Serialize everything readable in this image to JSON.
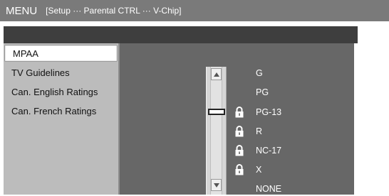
{
  "header": {
    "menu_label": "MENU",
    "breadcrumb": "[Setup ··· Parental CTRL ··· V-Chip]"
  },
  "sidebar": {
    "items": [
      {
        "label": "MPAA",
        "selected": true
      },
      {
        "label": "TV Guidelines",
        "selected": false
      },
      {
        "label": "Can. English Ratings",
        "selected": false
      },
      {
        "label": "Can. French Ratings",
        "selected": false
      }
    ]
  },
  "ratings": {
    "items": [
      {
        "label": "G",
        "locked": false
      },
      {
        "label": "PG",
        "locked": false
      },
      {
        "label": "PG-13",
        "locked": true
      },
      {
        "label": "R",
        "locked": true
      },
      {
        "label": "NC-17",
        "locked": true
      },
      {
        "label": "X",
        "locked": true
      },
      {
        "label": "NONE",
        "locked": false
      }
    ],
    "lock_icon": "padlock-icon",
    "slider_position": "PG-13"
  },
  "colors": {
    "topbar": "#7a7a7a",
    "panel": "#676767",
    "sidebar": "#bcbcbc",
    "header_band": "#3e3e3e"
  }
}
